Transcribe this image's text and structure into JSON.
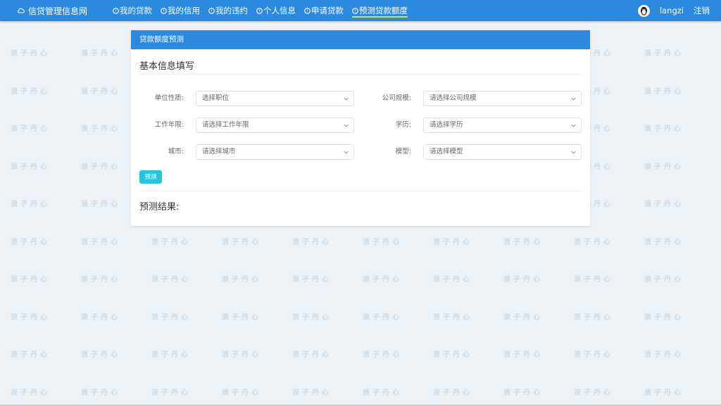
{
  "navbar": {
    "brand": "信贷管理信息网",
    "items": [
      {
        "label": "我的贷款"
      },
      {
        "label": "我的信用"
      },
      {
        "label": "我的违约"
      },
      {
        "label": "个人信息"
      },
      {
        "label": "申请贷款"
      },
      {
        "label": "预测贷款额度"
      }
    ],
    "active_index": 5,
    "username": "langzi",
    "logout": "注销"
  },
  "card": {
    "header": "贷款额度预测",
    "section_title": "基本信息填写",
    "form": {
      "unit_nature": {
        "label": "单位性质:",
        "placeholder": "选择职位"
      },
      "company_size": {
        "label": "公司规模:",
        "placeholder": "请选择公司规模"
      },
      "work_years": {
        "label": "工作年限:",
        "placeholder": "请选择工作年限"
      },
      "education": {
        "label": "学历:",
        "placeholder": "请选择学历"
      },
      "city": {
        "label": "城市:",
        "placeholder": "请选择城市"
      },
      "model": {
        "label": "模型:",
        "placeholder": "请选择模型"
      }
    },
    "predict_button": "预测",
    "result_label": "预测结果:"
  },
  "watermark": {
    "text": "浪子丹心"
  },
  "colors": {
    "primary": "#2b8ae0",
    "accent_button": "#26c6da",
    "active_underline": "#e6e600",
    "background": "#edf2f7"
  }
}
